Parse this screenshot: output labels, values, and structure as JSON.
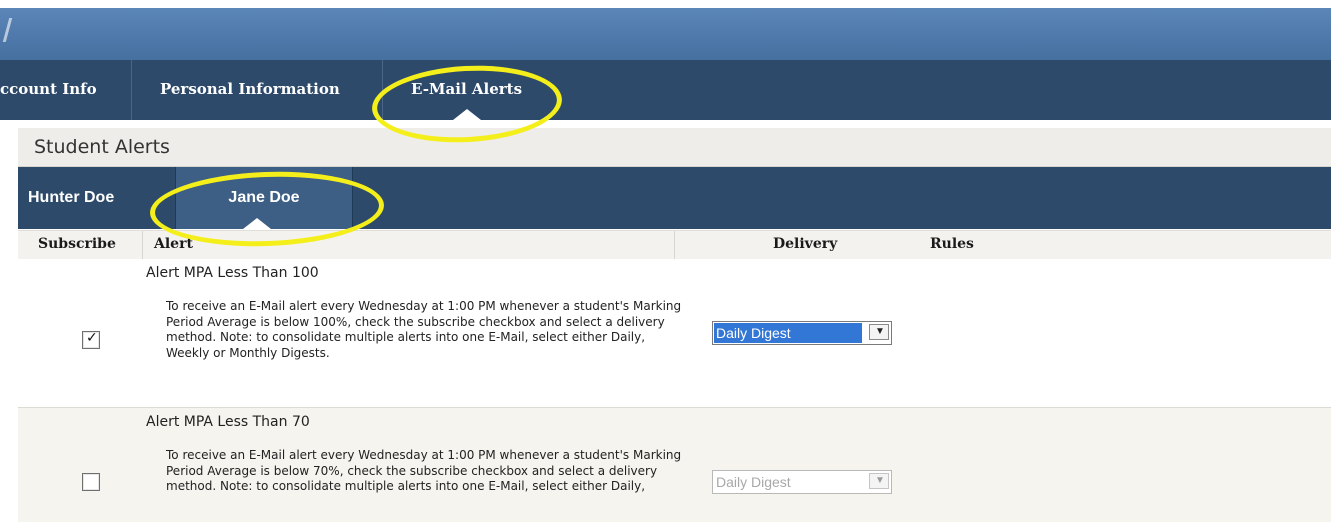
{
  "nav": {
    "tabs": [
      {
        "label": "ccount Info"
      },
      {
        "label": "Personal Information"
      },
      {
        "label": "E-Mail Alerts",
        "active": true
      }
    ]
  },
  "section": {
    "title": "Student Alerts"
  },
  "students": {
    "tabs": [
      {
        "label": "Hunter Doe"
      },
      {
        "label": "Jane Doe",
        "active": true
      }
    ]
  },
  "table": {
    "headers": {
      "subscribe": "Subscribe",
      "alert": "Alert",
      "delivery": "Delivery",
      "rules": "Rules"
    },
    "rows": [
      {
        "title": "Alert MPA Less Than 100",
        "description": "To receive an E-Mail alert every Wednesday at 1:00 PM whenever a student's Marking Period Average is below 100%, check the subscribe checkbox and select a delivery method. Note: to consolidate multiple alerts into one E-Mail, select either Daily, Weekly or Monthly Digests.",
        "subscribed": true,
        "checkmark": "✓",
        "delivery": "Daily Digest",
        "delivery_enabled": true
      },
      {
        "title": "Alert MPA Less Than 70",
        "description": "To receive an E-Mail alert every Wednesday at 1:00 PM whenever a student's Marking Period Average is below 70%, check the subscribe checkbox and select a delivery method. Note: to consolidate multiple alerts into one E-Mail, select either Daily,",
        "subscribed": false,
        "delivery": "Daily Digest",
        "delivery_enabled": false
      }
    ]
  },
  "icons": {
    "dropdown_arrow": "chevron-down-icon",
    "checkmark": "check-icon"
  },
  "colors": {
    "banner": "#4e78a9",
    "nav": "#2e4a6b",
    "highlight": "#f4ef1a",
    "selected_option": "#3377d6"
  }
}
